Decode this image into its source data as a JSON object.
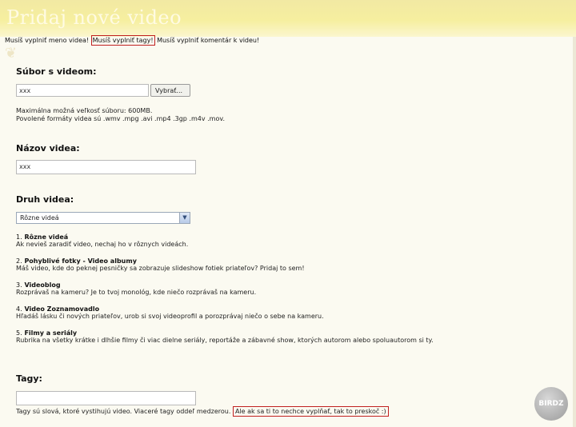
{
  "page": {
    "title": "Pridaj nové video"
  },
  "errors": [
    {
      "text": "Musíš vyplniť meno videa!"
    },
    {
      "text": "Musíš vyplniť tagy!"
    },
    {
      "text": "Musíš vyplniť komentár k videu!"
    }
  ],
  "file_section": {
    "title": "Súbor s videom:",
    "file_value": "xxx",
    "browse_label": "Vybrať...",
    "note_max": "Maximálna možná veľkosť súboru: 600MB.",
    "note_formats": "Povolené formáty videa sú .wmv .mpg .avi .mp4 .3gp .m4v .mov."
  },
  "name_section": {
    "title": "Názov videa:",
    "value": "xxx"
  },
  "type_section": {
    "title": "Druh videa:",
    "selected": "Rôzne videá",
    "categories": [
      {
        "num": "1.",
        "name": "Rôzne videá",
        "desc": "Ak nevieš zaradiť video, nechaj ho v rôznych videách."
      },
      {
        "num": "2.",
        "name": "Pohyblivé fotky - Video albumy",
        "desc": "Máš video, kde do peknej pesničky sa zobrazuje slideshow fotiek priateľov? Pridaj to sem!"
      },
      {
        "num": "3.",
        "name": "Videoblog",
        "desc": "Rozprávaš na kameru? Je to tvoj monológ, kde niečo rozprávaš na kameru."
      },
      {
        "num": "4.",
        "name": "Video Zoznamovadlo",
        "desc": "Hľadáš lásku či nových priateľov, urob si svoj videoprofil a porozprávaj niečo o sebe na kameru."
      },
      {
        "num": "5.",
        "name": "Filmy a seriály",
        "desc": "Rubrika na všetky krátke i dlhšie filmy či viac dielne seriály, reportáže a zábavné show, ktorých autorom alebo spoluautorom si ty."
      }
    ]
  },
  "tags_section": {
    "title": "Tagy:",
    "value": "",
    "hint": "Tagy sú slová, ktoré vystihujú video. Viaceré tagy oddeľ medzerou.",
    "hint_boxed": "Ale ak sa ti to nechce vyplňať, tak to preskoč :)"
  },
  "logo": {
    "text": "BIRDZ"
  }
}
